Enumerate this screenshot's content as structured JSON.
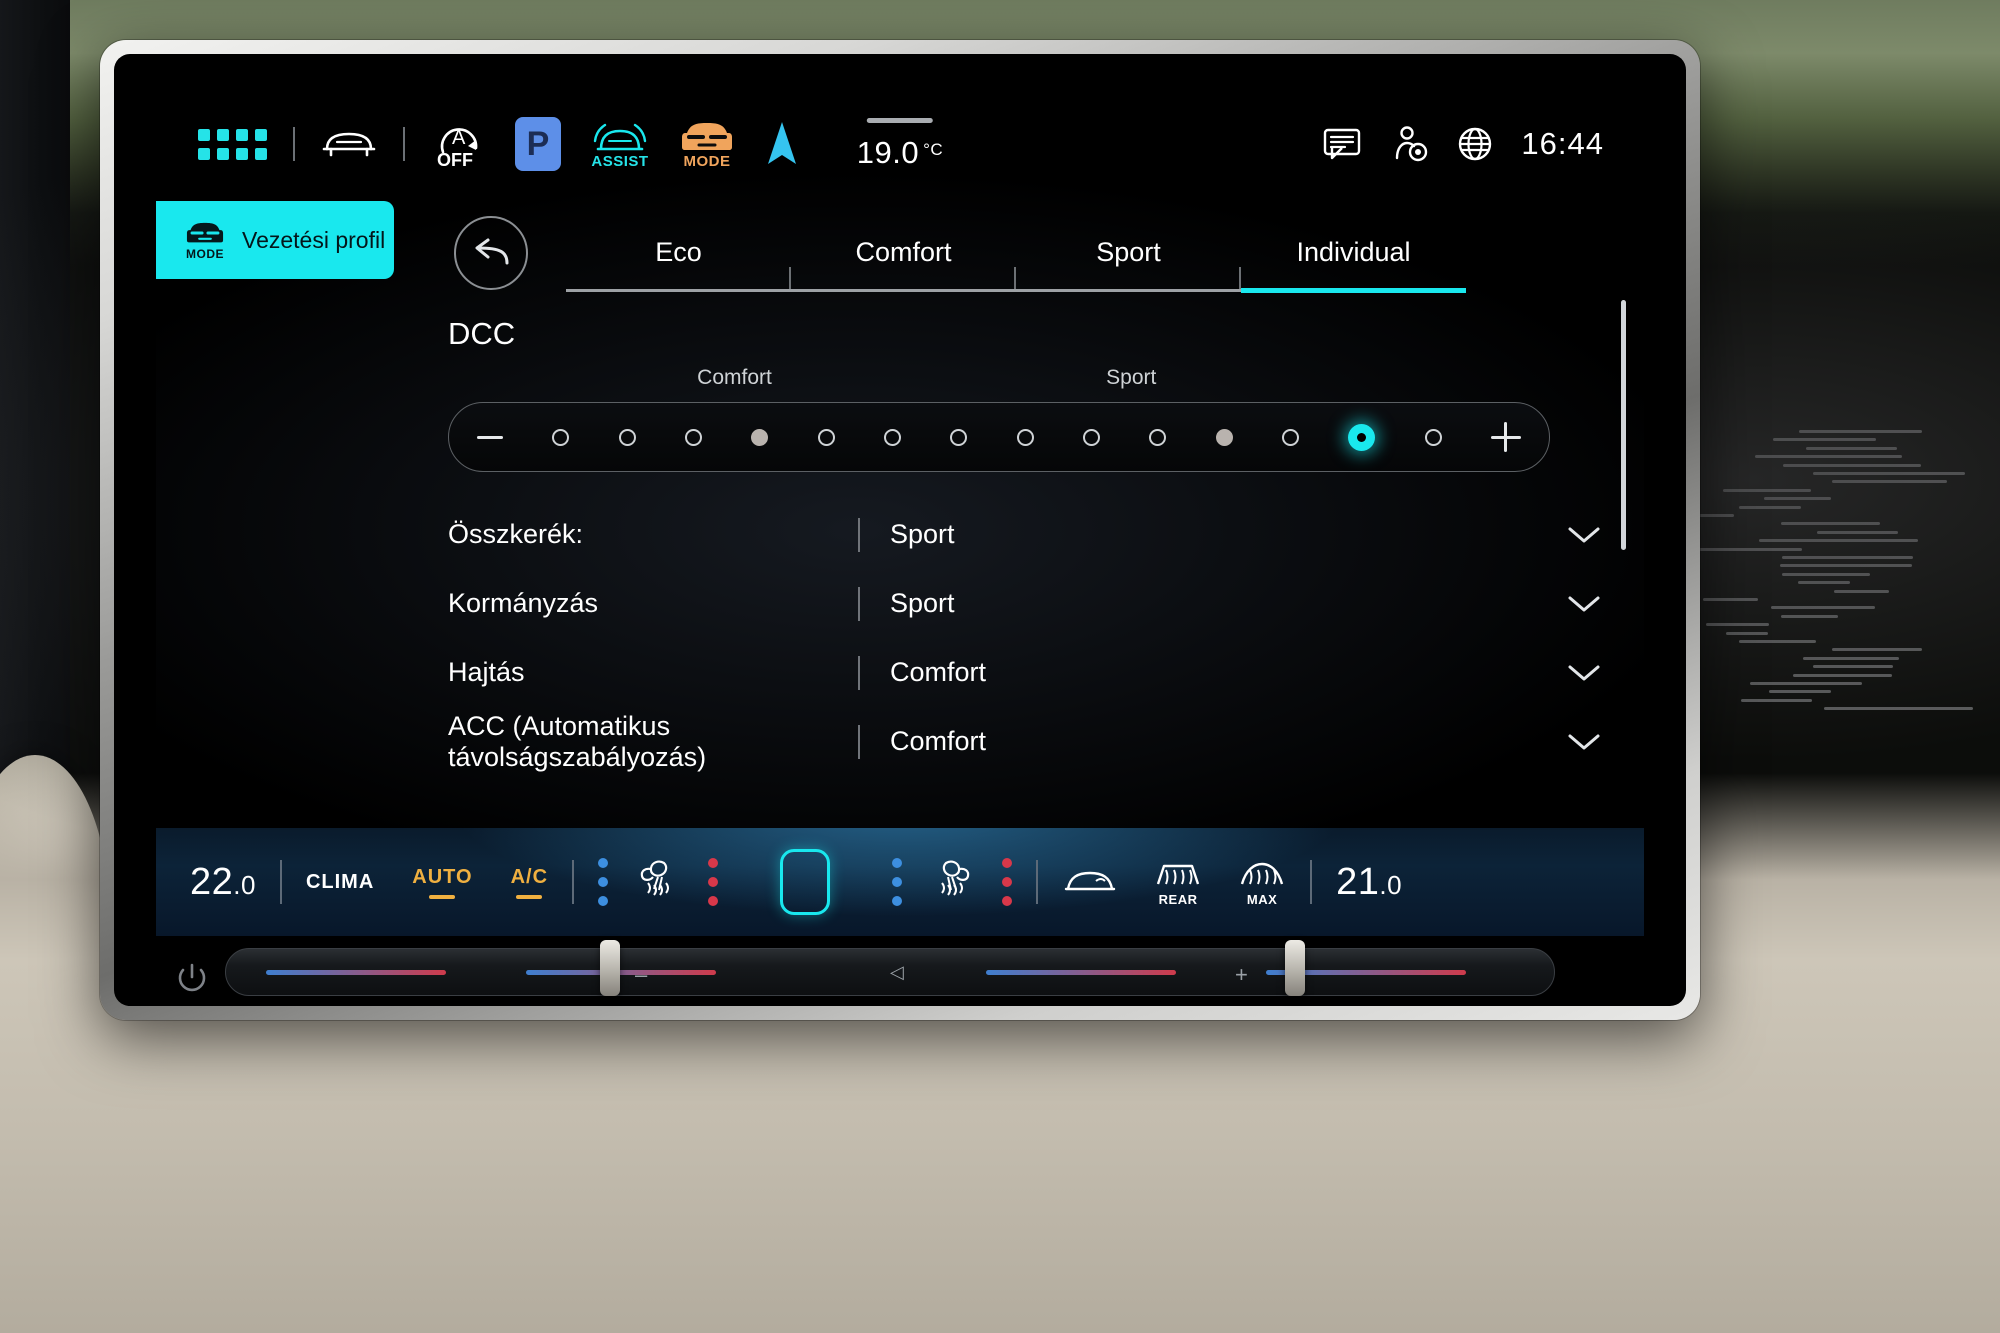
{
  "statusbar": {
    "apps_icon": "app-grid-icon",
    "car_icon": "vehicle-front-icon",
    "auto_start_stop": {
      "icon": "auto-start-stop-off-icon",
      "label": "OFF"
    },
    "park_badge": "P",
    "assist": {
      "icon": "travel-assist-icon",
      "label": "ASSIST"
    },
    "drive_mode": {
      "icon": "drive-mode-car-icon",
      "label": "MODE"
    },
    "navigation_icon": "navigation-arrow-icon",
    "outside_temp": "19.0",
    "temp_unit": "°C",
    "message_icon": "message-bubble-icon",
    "profile_icon": "user-location-icon",
    "globe_icon": "globe-icon",
    "clock": "16:44"
  },
  "profile_tab": {
    "icon": "drive-mode-car-icon",
    "icon_label": "MODE",
    "label": "Vezetési profil"
  },
  "panel": {
    "back_icon": "back-arrow-icon",
    "tabs": [
      {
        "label": "Eco",
        "active": false
      },
      {
        "label": "Comfort",
        "active": false
      },
      {
        "label": "Sport",
        "active": false
      },
      {
        "label": "Individual",
        "active": true
      }
    ],
    "section_title": "DCC",
    "slider": {
      "left_label": "Comfort",
      "right_label": "Sport",
      "minus_label": "−",
      "plus_label": "+",
      "total_steps": 14,
      "selected_index": 12,
      "tick_indices": [
        3,
        10
      ],
      "accent_color": "#19e8ee"
    },
    "rows": [
      {
        "label": "Összkerék:",
        "value": "Sport",
        "chevron": "chevron-down-icon"
      },
      {
        "label": "Kormányzás",
        "value": "Sport",
        "chevron": "chevron-down-icon"
      },
      {
        "label": "Hajtás",
        "value": "Comfort",
        "chevron": "chevron-down-icon"
      },
      {
        "label": "ACC (Automatikus távolságszabályozás)",
        "value": "Comfort",
        "chevron": "chevron-down-icon"
      }
    ]
  },
  "climate": {
    "left_temp_int": "22",
    "left_temp_dec": ".0",
    "clima_label": "CLIMA",
    "auto_label": "AUTO",
    "ac_label": "A/C",
    "left_seat_icon": "seat-heating-icon",
    "center_square_icon": "center-vent-icon",
    "right_seat_icon": "seat-heating-icon",
    "windshield_icon": "windshield-defrost-icon",
    "rear_label": "REAR",
    "max_label": "MAX",
    "right_temp_int": "21",
    "right_temp_dec": ".0"
  },
  "colors": {
    "accent_cyan": "#19e8ee",
    "amber": "#f0b040",
    "park_blue": "#5d8fe8",
    "mode_orange": "#f0a45c",
    "blue_dots": "#3d8fe0",
    "red_dots": "#d8384a"
  }
}
